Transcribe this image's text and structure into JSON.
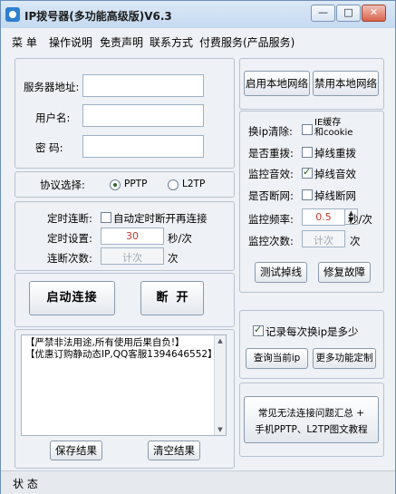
{
  "window": {
    "title": "IP拨号器(多功能高级版)V6.3",
    "controls": {
      "minimize": "—",
      "maximize": "□",
      "close": "✕"
    }
  },
  "menu": [
    "菜 单",
    "操作说明",
    "免责声明",
    "联系方式",
    "付费服务(产品服务)"
  ],
  "server": {
    "address_label": "服务器地址:",
    "username_label": "用户名:",
    "password_label": "密  码:",
    "address_value": "",
    "username_value": "",
    "password_value": ""
  },
  "protocol": {
    "label": "协议选择:",
    "options": [
      "PPTP",
      "L2TP"
    ],
    "selected": "PPTP"
  },
  "timer": {
    "disconnect_label": "定时连断:",
    "auto_reconnect_label": "自动定时断开再连接",
    "auto_reconnect_checked": false,
    "setting_label": "定时设置:",
    "setting_value": "30",
    "setting_unit": "秒/次",
    "count_label": "连断次数:",
    "count_placeholder": "计次",
    "count_unit": "次"
  },
  "actions": {
    "start": "启动连接",
    "stop": "断  开"
  },
  "log": {
    "lines": [
      "【严禁非法用途,所有使用后果自负!】",
      "【优惠订购静动态IP,QQ客服1394646552】"
    ],
    "save": "保存结果",
    "clear": "清空结果"
  },
  "network": {
    "enable": "启用本地网络",
    "disable": "禁用本地网络"
  },
  "options": {
    "clear_ip_label": "换ip清除:",
    "clear_ip_text_1": "IE缓存",
    "clear_ip_text_2": "和cookie",
    "clear_ip_checked": false,
    "redial_label": "是否重拨:",
    "redial_text": "掉线重拨",
    "redial_checked": false,
    "sound_label": "监控音效:",
    "sound_text": "掉线音效",
    "sound_checked": true,
    "break_label": "是否断网:",
    "break_text": "掉线断网",
    "break_checked": false,
    "freq_label": "监控频率:",
    "freq_value": "0.5",
    "freq_unit": "秒/次",
    "monitor_count_label": "监控次数:",
    "monitor_count_placeholder": "计次",
    "monitor_count_unit": "次",
    "test_drop": "测试掉线",
    "repair": "修复故障"
  },
  "records": {
    "log_each_label": "记录每次换ip是多少",
    "log_each_checked": true,
    "query_ip": "查询当前ip",
    "more_custom": "更多功能定制"
  },
  "help": {
    "line1": "常见无法连接问题汇总 +",
    "line2": "手机PPTP、L2TP图文教程"
  },
  "status": {
    "text": "状 态"
  }
}
